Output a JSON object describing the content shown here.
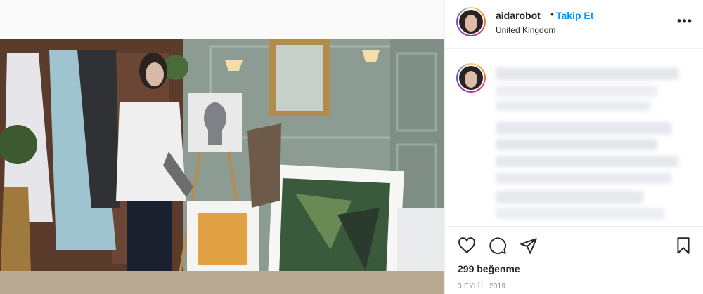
{
  "post": {
    "username": "aidarobot",
    "separator": "•",
    "follow_label": "Takip Et",
    "location": "United Kingdom",
    "more_label": "•••",
    "likes": "299 beğenme",
    "date": "3 EYLÜL 2019"
  },
  "icons": {
    "like": "heart-icon",
    "comment": "comment-icon",
    "share": "share-icon",
    "save": "bookmark-icon",
    "more": "more-options-icon"
  },
  "colors": {
    "follow_blue": "#0095f6",
    "story_ring": "#d62976",
    "date_gray": "#8e8e8e"
  }
}
